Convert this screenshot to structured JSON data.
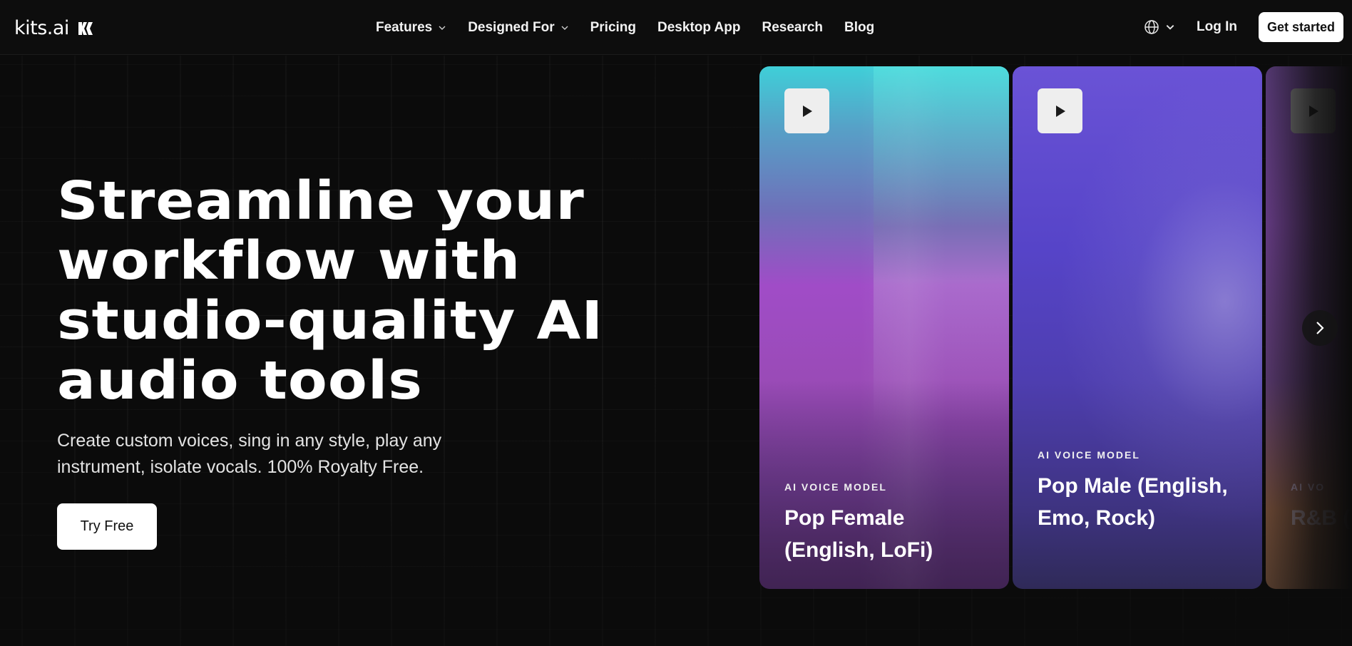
{
  "brand": {
    "name": "kits.ai"
  },
  "nav": {
    "items": [
      {
        "label": "Features",
        "dropdown": true
      },
      {
        "label": "Designed For",
        "dropdown": true
      },
      {
        "label": "Pricing",
        "dropdown": false
      },
      {
        "label": "Desktop App",
        "dropdown": false
      },
      {
        "label": "Research",
        "dropdown": false
      },
      {
        "label": "Blog",
        "dropdown": false
      }
    ],
    "login_label": "Log In",
    "cta_label": "Get started",
    "language_icon": "globe-icon"
  },
  "hero": {
    "title": "Streamline your workflow with studio-quality AI audio tools",
    "subtitle": "Create custom voices, sing in any style, play any instrument, isolate vocals. 100% Royalty Free.",
    "cta_label": "Try Free"
  },
  "cards": [
    {
      "tag": "AI VOICE MODEL",
      "title": "Pop Female (English, LoFi)"
    },
    {
      "tag": "AI VOICE MODEL",
      "title": "Pop Male (English, Emo, Rock)"
    },
    {
      "tag": "AI VO",
      "title": "R&B (En"
    }
  ],
  "colors": {
    "background": "#0b0b0b",
    "header": "#0d0d0d",
    "button_bg": "#ffffff",
    "button_text": "#111111"
  }
}
